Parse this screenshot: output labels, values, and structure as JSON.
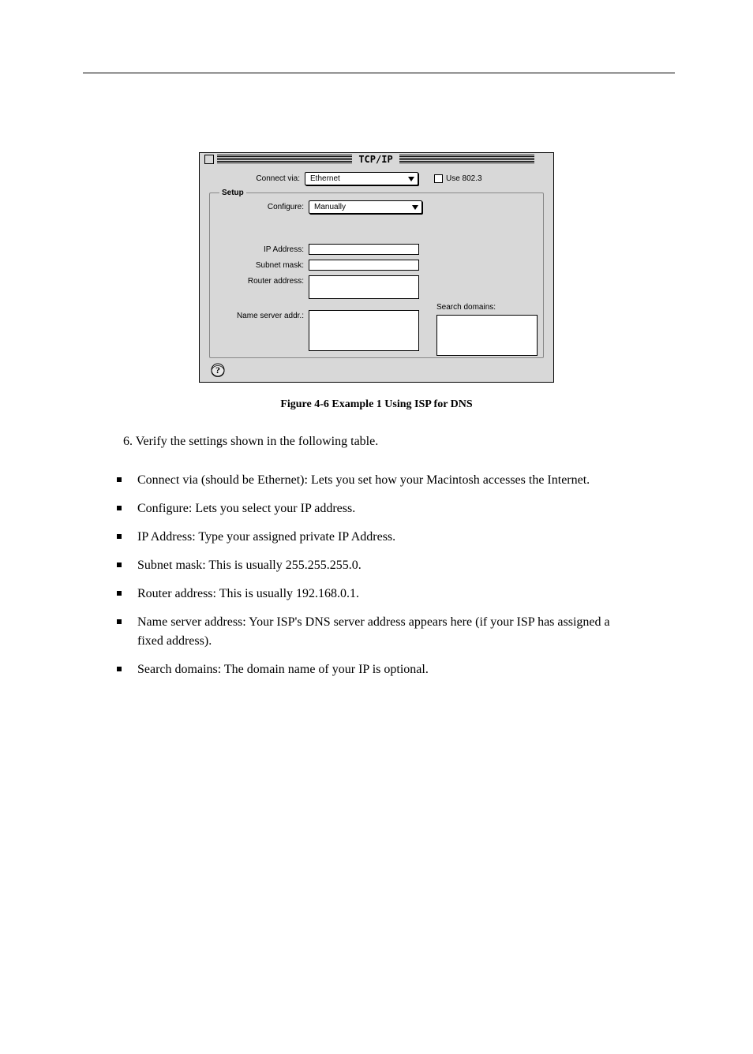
{
  "page": {
    "step": "6.  Verify the settings shown in the following table."
  },
  "dialog": {
    "title": "TCP/IP",
    "connect_via_label": "Connect via:",
    "connect_via_value": "Ethernet",
    "use_8023_label": "Use 802.3",
    "setup_legend": "Setup",
    "configure_label": "Configure:",
    "configure_value": "Manually",
    "ip_address_label": "IP Address:",
    "subnet_mask_label": "Subnet mask:",
    "router_address_label": "Router address:",
    "name_server_label": "Name server addr.:",
    "search_domains_label": "Search domains:"
  },
  "caption": "Figure 4-6 Example 1 Using ISP for DNS",
  "instructions": [
    "Connect via (should be Ethernet): Lets you set how your Macintosh accesses the Internet.",
    "Configure: Lets you select your IP address.",
    "IP Address: Type your assigned private IP Address.",
    "Subnet mask: This is usually 255.255.255.0.",
    "Router address: This is usually 192.168.0.1.",
    "Name server address: Your ISP's DNS server address appears here (if your ISP has assigned a fixed address).",
    "Search domains: The domain name of your IP is optional."
  ]
}
